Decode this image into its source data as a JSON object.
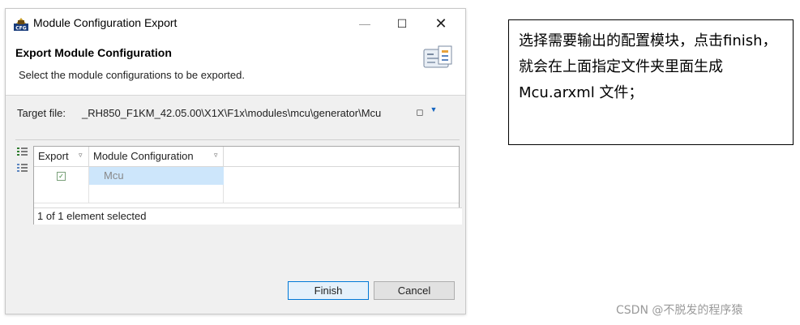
{
  "window": {
    "title": "Module Configuration Export",
    "minimize_glyph": "—",
    "maximize_glyph": "☐",
    "close_glyph": "✕",
    "app_icon": "cfg-icon"
  },
  "wizard": {
    "title": "Export Module Configuration",
    "description": "Select the module configurations to be exported.",
    "banner_icon": "export-wizard-icon"
  },
  "target": {
    "label": "Target file:",
    "value": "_RH850_F1KM_42.05.00\\X1X\\F1x\\modules\\mcu\\generator\\Mcu"
  },
  "table": {
    "columns": [
      "Export",
      "Module Configuration"
    ],
    "rows": [
      {
        "export_checked": true,
        "module": "Mcu"
      }
    ],
    "status": "1 of 1 element selected"
  },
  "buttons": {
    "finish": "Finish",
    "cancel": "Cancel"
  },
  "annotation": {
    "text": "选择需要输出的配置模块，点击finish，就会在上面指定文件夹里面生成 Mcu.arxml 文件；"
  },
  "watermark": "CSDN @不脱发的程序猿"
}
